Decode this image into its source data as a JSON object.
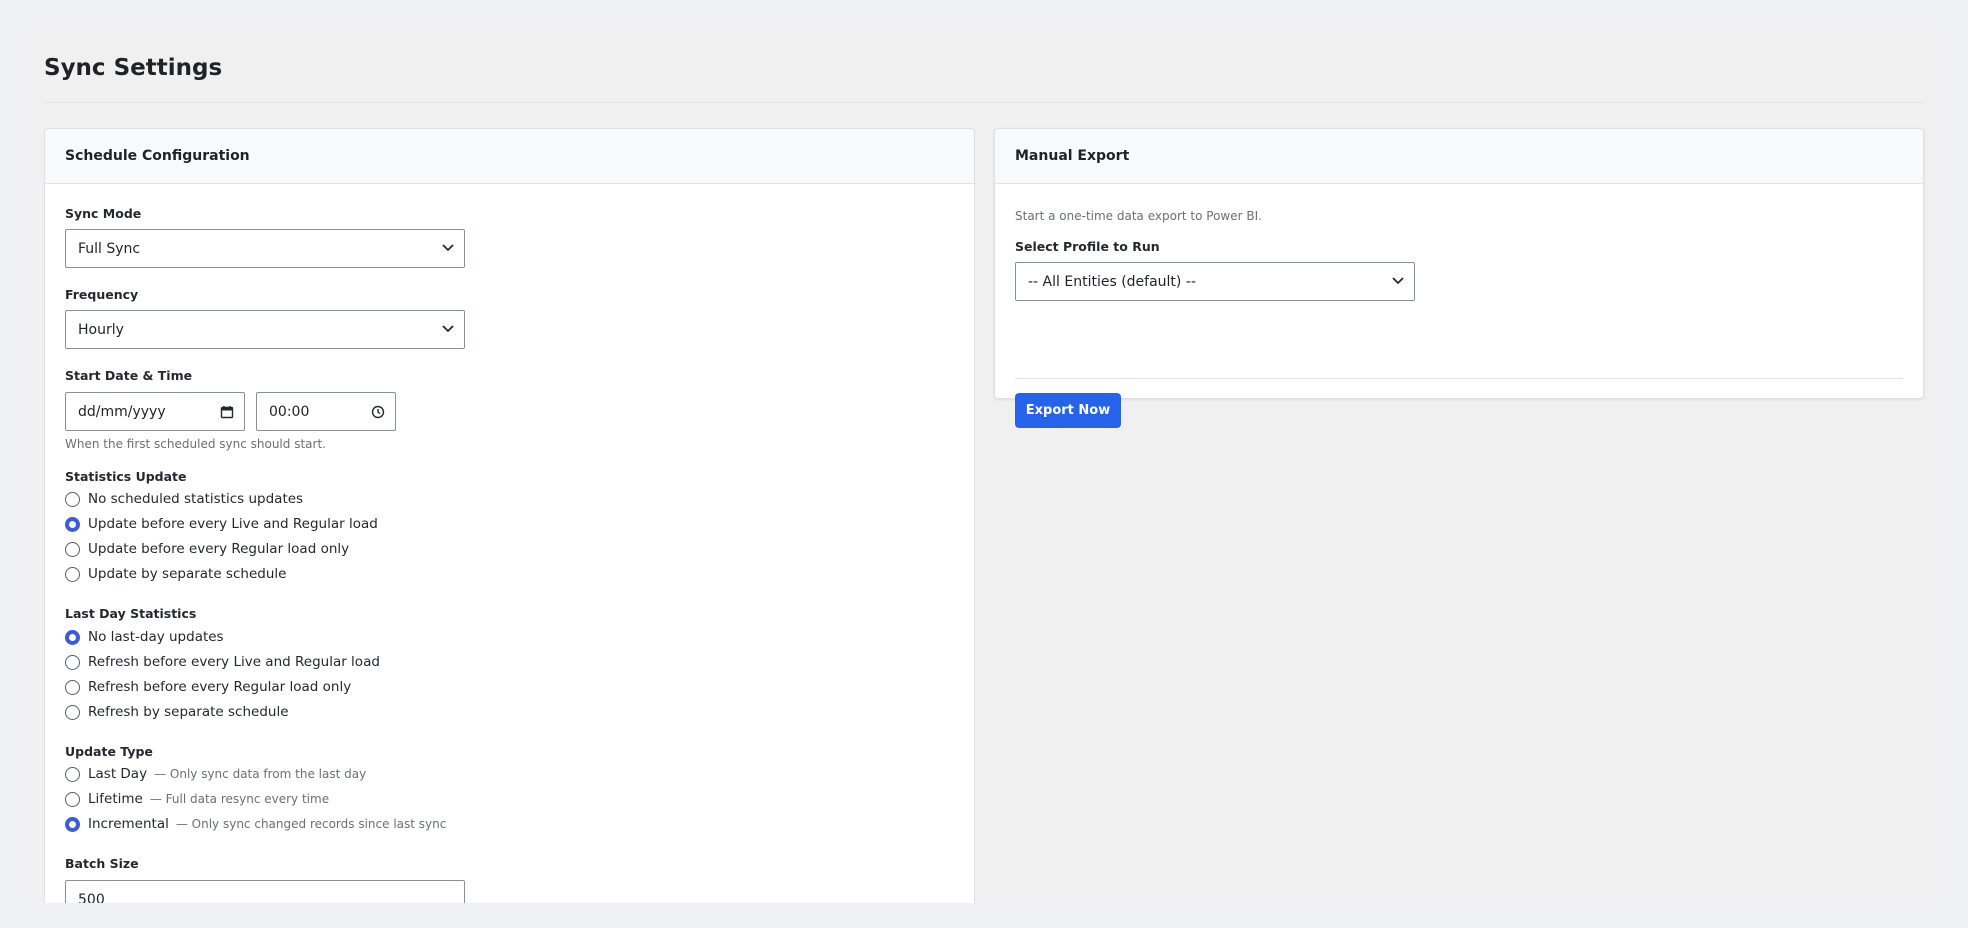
{
  "page": {
    "title": "Sync Settings"
  },
  "schedule": {
    "header": "Schedule Configuration",
    "sync_mode": {
      "label": "Sync Mode",
      "value": "Full Sync"
    },
    "frequency": {
      "label": "Frequency",
      "value": "Hourly"
    },
    "start": {
      "label": "Start Date & Time",
      "date_placeholder": "dd/mm/yyyy",
      "time_value": "00:00",
      "hint": "When the first scheduled sync should start."
    },
    "statistics": {
      "label": "Statistics Update",
      "options": [
        {
          "label": "No scheduled statistics updates",
          "selected": false
        },
        {
          "label": "Update before every Live and Regular load",
          "selected": true
        },
        {
          "label": "Update before every Regular load only",
          "selected": false
        },
        {
          "label": "Update by separate schedule",
          "selected": false
        }
      ]
    },
    "last_day": {
      "label": "Last Day Statistics",
      "options": [
        {
          "label": "No last-day updates",
          "selected": true
        },
        {
          "label": "Refresh before every Live and Regular load",
          "selected": false
        },
        {
          "label": "Refresh before every Regular load only",
          "selected": false
        },
        {
          "label": "Refresh by separate schedule",
          "selected": false
        }
      ]
    },
    "update_type": {
      "label": "Update Type",
      "options": [
        {
          "label": "Last Day",
          "desc": "— Only sync data from the last day",
          "selected": false
        },
        {
          "label": "Lifetime",
          "desc": "— Full data resync every time",
          "selected": false
        },
        {
          "label": "Incremental",
          "desc": "— Only sync changed records since last sync",
          "selected": true
        }
      ]
    },
    "batch": {
      "label": "Batch Size",
      "value": "500"
    }
  },
  "export": {
    "header": "Manual Export",
    "intro": "Start a one-time data export to Power BI.",
    "profile_label": "Select Profile to Run",
    "profile_value": "-- All Entities (default) --",
    "button": "Export Now"
  },
  "colors": {
    "accent": "#2563eb",
    "radio_on": "#3b5bdb"
  }
}
